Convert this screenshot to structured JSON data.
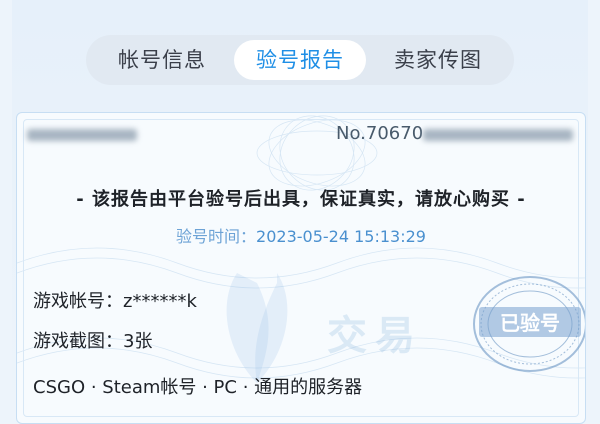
{
  "tabs": [
    {
      "label": "帐号信息"
    },
    {
      "label": "验号报告"
    },
    {
      "label": "卖家传图"
    }
  ],
  "active_tab": 1,
  "report": {
    "number": "No.70670",
    "headline": "- 该报告由平台验号后出具，保证真实，请放心购买 -",
    "time_label": "验号时间：",
    "time_value": "2023-05-24 15:13:29",
    "account_row": "游戏帐号：z******k",
    "screenshot_row": "游戏截图：3张",
    "tags_row": "CSGO · Steam帐号 · PC · 通用的服务器"
  },
  "watermark": {
    "text": "交易",
    "seal_text": "已验号"
  },
  "colors": {
    "accent": "#1f8fe6",
    "tab_bg": "#e1e9f2",
    "time_text": "#4a90cf"
  }
}
